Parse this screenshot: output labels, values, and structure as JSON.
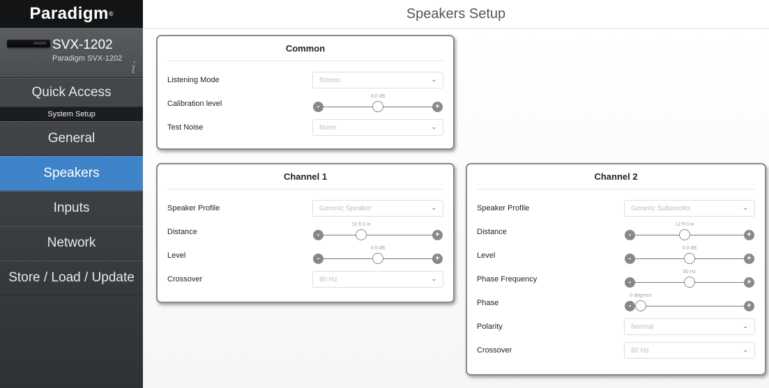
{
  "brand": {
    "name": "Paradigm",
    "reg": "®"
  },
  "device": {
    "model": "SVX-1202",
    "subtitle": "Paradigm SVX-1202",
    "info_icon": "i"
  },
  "nav": {
    "quick_access": "Quick Access",
    "section": "System Setup",
    "items": [
      "General",
      "Speakers",
      "Inputs",
      "Network",
      "Store / Load / Update"
    ]
  },
  "header": {
    "title": "Speakers Setup"
  },
  "common": {
    "title": "Common",
    "listening_mode": {
      "label": "Listening Mode",
      "value": "Stereo"
    },
    "calibration": {
      "label": "Calibration level",
      "value": "0.0 dB",
      "position": 0.5
    },
    "test_noise": {
      "label": "Test Noise",
      "value": "None"
    }
  },
  "channel1": {
    "title": "Channel 1",
    "speaker_profile": {
      "label": "Speaker Profile",
      "value": "Generic Speaker"
    },
    "distance": {
      "label": "Distance",
      "value": "12 ft 0 in",
      "position": 0.33
    },
    "level": {
      "label": "Level",
      "value": "0.0 dB",
      "position": 0.5
    },
    "crossover": {
      "label": "Crossover",
      "value": "80 Hz"
    }
  },
  "channel2": {
    "title": "Channel 2",
    "speaker_profile": {
      "label": "Speaker Profile",
      "value": "Generic Subwoofer"
    },
    "distance": {
      "label": "Distance",
      "value": "12 ft 0 in",
      "position": 0.45
    },
    "level": {
      "label": "Level",
      "value": "0.0 dB",
      "position": 0.5
    },
    "phase_frequency": {
      "label": "Phase Frequency",
      "value": "80 Hz",
      "position": 0.5
    },
    "phase": {
      "label": "Phase",
      "value": "0 degrees",
      "position": 0.0
    },
    "polarity": {
      "label": "Polarity",
      "value": "Normal"
    },
    "crossover": {
      "label": "Crossover",
      "value": "80 Hz"
    }
  },
  "controls": {
    "minus": "-",
    "plus": "+",
    "chevron": "⌄"
  },
  "colors": {
    "accent": "#3f84c8",
    "sidebar": "#45484b",
    "brand_bar": "#131415"
  }
}
